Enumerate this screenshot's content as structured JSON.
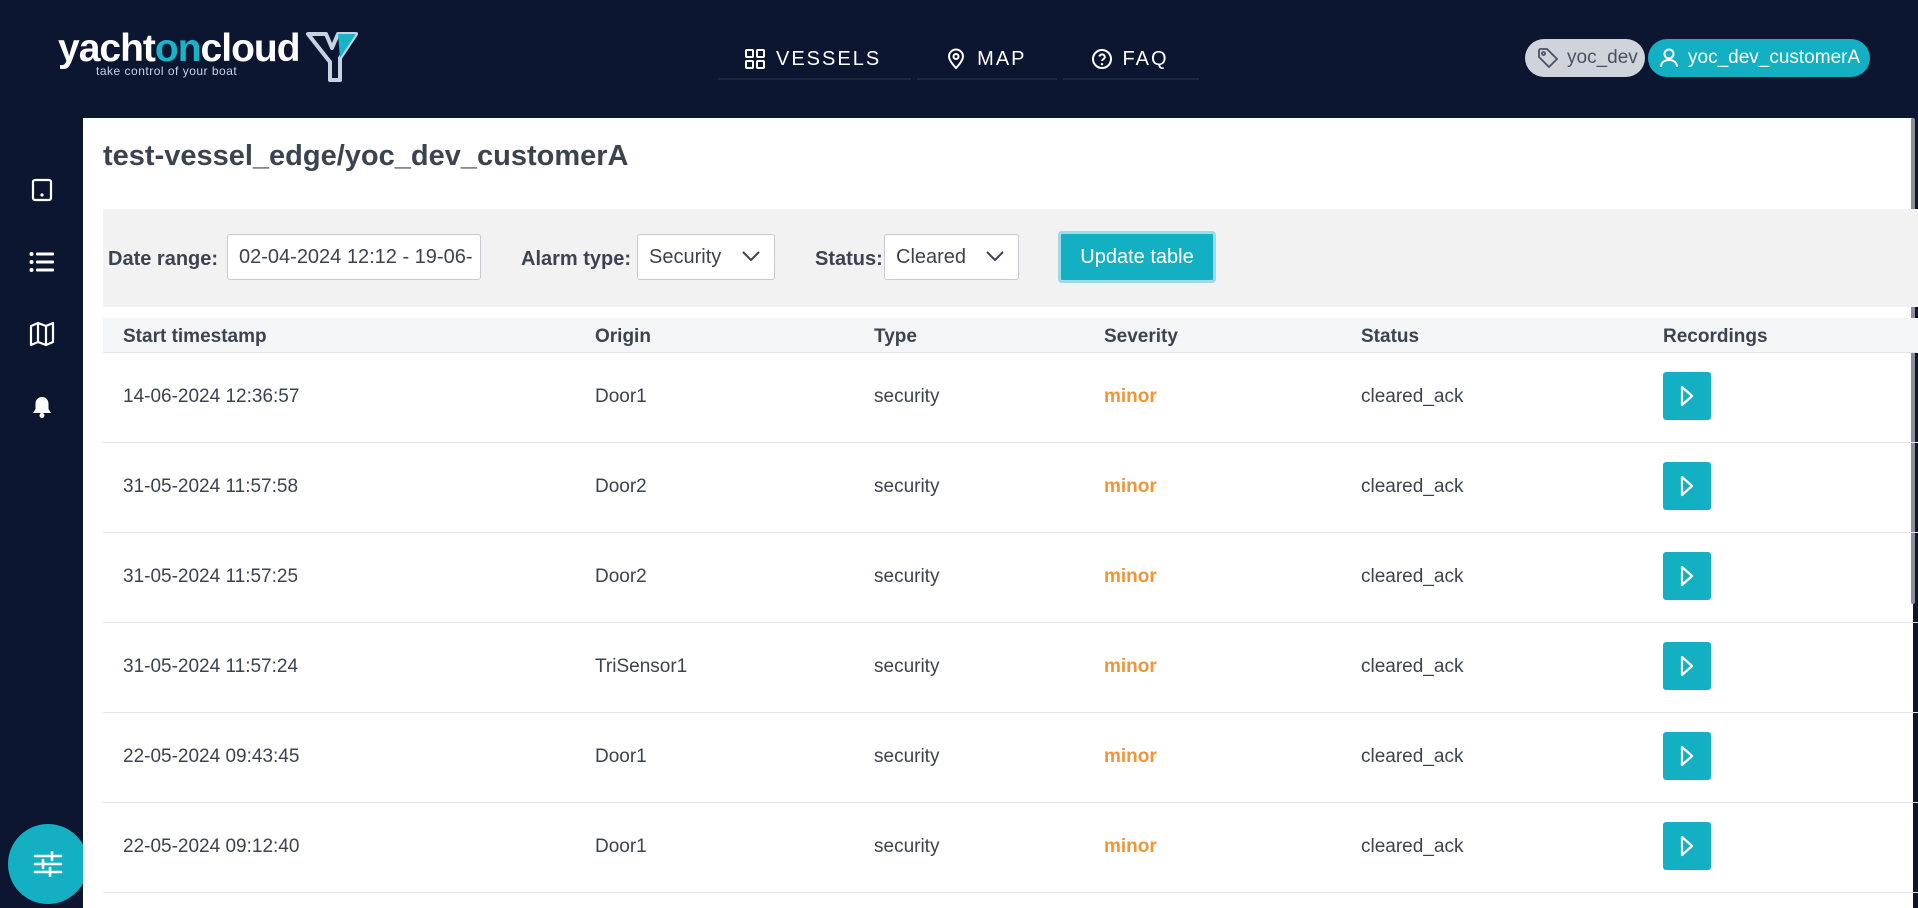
{
  "brand": {
    "name_part1": "yacht",
    "name_part2": "on",
    "name_part3": "cloud",
    "tagline": "take control of your boat",
    "accent_color": "#19b3c8"
  },
  "nav": {
    "items": [
      {
        "label": "VESSELS",
        "icon": "grid-icon"
      },
      {
        "label": "MAP",
        "icon": "map-pin-icon"
      },
      {
        "label": "FAQ",
        "icon": "help-circle-icon"
      }
    ]
  },
  "header": {
    "tag_chip": "yoc_dev",
    "user_chip": "yoc_dev_customerA"
  },
  "sidebar": {
    "icons": [
      "tablet-icon",
      "list-icon",
      "map-icon",
      "bell-icon"
    ],
    "fab_icon": "sliders-icon"
  },
  "page": {
    "title": "test-vessel_edge/yoc_dev_customerA"
  },
  "filters": {
    "date_range_label": "Date range:",
    "date_range_value": "02-04-2024 12:12 - 19-06-",
    "alarm_type_label": "Alarm type:",
    "alarm_type_value": "Security",
    "status_label": "Status:",
    "status_value": "Cleared",
    "update_button": "Update table"
  },
  "table": {
    "headers": {
      "start": "Start timestamp",
      "origin": "Origin",
      "type": "Type",
      "severity": "Severity",
      "status": "Status",
      "recordings": "Recordings"
    },
    "rows": [
      {
        "start": "14-06-2024 12:36:57",
        "origin": "Door1",
        "type": "security",
        "severity": "minor",
        "status": "cleared_ack"
      },
      {
        "start": "31-05-2024 11:57:58",
        "origin": "Door2",
        "type": "security",
        "severity": "minor",
        "status": "cleared_ack"
      },
      {
        "start": "31-05-2024 11:57:25",
        "origin": "Door2",
        "type": "security",
        "severity": "minor",
        "status": "cleared_ack"
      },
      {
        "start": "31-05-2024 11:57:24",
        "origin": "TriSensor1",
        "type": "security",
        "severity": "minor",
        "status": "cleared_ack"
      },
      {
        "start": "22-05-2024 09:43:45",
        "origin": "Door1",
        "type": "security",
        "severity": "minor",
        "status": "cleared_ack"
      },
      {
        "start": "22-05-2024 09:12:40",
        "origin": "Door1",
        "type": "security",
        "severity": "minor",
        "status": "cleared_ack"
      }
    ]
  },
  "colors": {
    "background": "#0d1631",
    "primary": "#13b0c4",
    "severity_minor": "#f0953a"
  }
}
